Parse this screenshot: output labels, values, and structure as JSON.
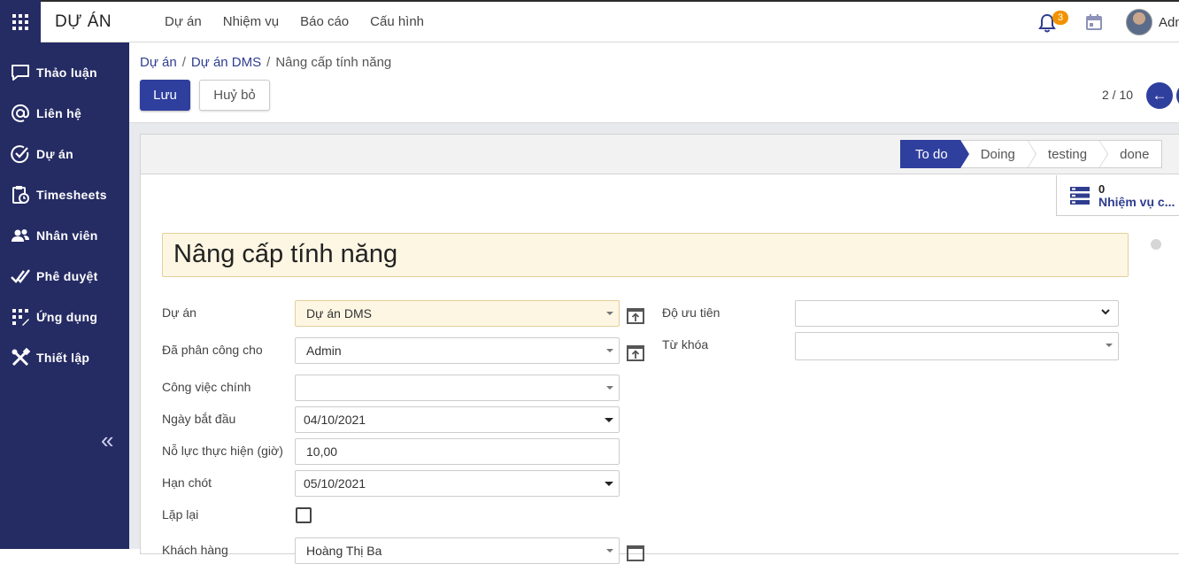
{
  "app": {
    "title": "DỰ ÁN",
    "menu": [
      "Dự án",
      "Nhiệm vụ",
      "Báo cáo",
      "Cấu hình"
    ],
    "notification_count": "3",
    "user_name": "Admin"
  },
  "sidebar": {
    "items": [
      {
        "label": "Thảo luận",
        "icon": "chat-icon"
      },
      {
        "label": "Liên hệ",
        "icon": "at-sign-icon"
      },
      {
        "label": "Dự án",
        "icon": "check-circle-icon"
      },
      {
        "label": "Timesheets",
        "icon": "clipboard-clock-icon"
      },
      {
        "label": "Nhân viên",
        "icon": "users-icon"
      },
      {
        "label": "Phê duyệt",
        "icon": "double-check-icon"
      },
      {
        "label": "Ứng dụng",
        "icon": "apps-icon"
      },
      {
        "label": "Thiết lập",
        "icon": "tools-icon"
      }
    ],
    "collapse_symbol": "«"
  },
  "breadcrumb": {
    "items": [
      "Dự án",
      "Dự án DMS",
      "Nâng cấp tính năng"
    ],
    "separator": "/"
  },
  "toolbar": {
    "save_label": "Lưu",
    "cancel_label": "Huỷ bỏ"
  },
  "pager": {
    "text": "2 / 10",
    "prev_symbol": "←"
  },
  "stages": {
    "items": [
      "To do",
      "Doing",
      "testing",
      "done"
    ],
    "active": "To do"
  },
  "smart_button": {
    "count": "0",
    "label": "Nhiệm vụ c..."
  },
  "form": {
    "title": "Nâng cấp tính năng",
    "left": {
      "project": {
        "label": "Dự án",
        "value": "Dự án DMS"
      },
      "assigned": {
        "label": "Đã phân công cho",
        "value": "Admin"
      },
      "parent_task": {
        "label": "Công việc chính",
        "value": ""
      },
      "start_date": {
        "label": "Ngày bắt đầu",
        "value": "04/10/2021"
      },
      "effort": {
        "label": "Nỗ lực thực hiện (giờ)",
        "value": "10,00"
      },
      "deadline": {
        "label": "Hạn chót",
        "value": "05/10/2021"
      },
      "repeat": {
        "label": "Lặp lại",
        "checked": false
      },
      "customer": {
        "label": "Khách hàng",
        "value": "Hoàng Thị Ba"
      }
    },
    "right": {
      "priority": {
        "label": "Độ ưu tiên",
        "value": ""
      },
      "tags": {
        "label": "Từ khóa",
        "value": ""
      }
    }
  },
  "colors": {
    "primary": "#2f3f9e",
    "sidebar": "#252b63",
    "required_field_bg": "#fdf6e3",
    "badge": "#f29200"
  }
}
